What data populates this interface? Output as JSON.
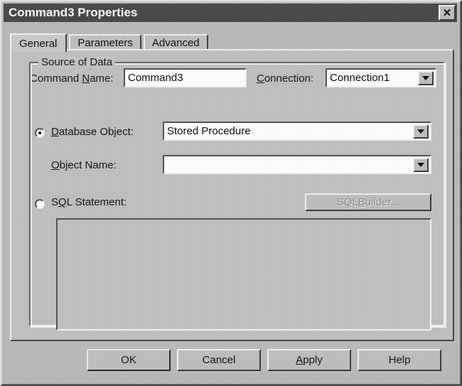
{
  "window": {
    "title": "Command3 Properties",
    "close_label": "✕",
    "close_icon": "close-icon"
  },
  "tabs": [
    {
      "label": "General",
      "active": true
    },
    {
      "label": "Parameters",
      "active": false
    },
    {
      "label": "Advanced",
      "active": false
    }
  ],
  "general": {
    "command_name": {
      "label_pre": "Command ",
      "label_accel": "N",
      "label_post": "ame:",
      "value": "Command3",
      "placeholder": ""
    },
    "connection": {
      "label_pre": "",
      "label_accel": "C",
      "label_post": "onnection:",
      "value": "Connection1",
      "options": [
        "Connection1"
      ]
    },
    "source_of_data": {
      "group_title": "Source of Data",
      "database_object": {
        "selected": true,
        "label_pre": "",
        "label_accel": "D",
        "label_post": "atabase Object:",
        "value": "Stored Procedure",
        "options": [
          "Stored Procedure"
        ]
      },
      "object_name": {
        "label_pre": "",
        "label_accel": "O",
        "label_post": "bject Name:",
        "value": "",
        "options": []
      },
      "sql_statement": {
        "selected": false,
        "label_pre": "S",
        "label_accel": "Q",
        "label_post": "L Statement:",
        "text": "",
        "enabled": false
      },
      "sql_builder_button": {
        "label_pre": "SQL ",
        "label_accel": "B",
        "label_post": "uilder...",
        "enabled": false
      }
    }
  },
  "footer": {
    "buttons": [
      {
        "label_pre": "OK",
        "label_accel": "",
        "label_post": "",
        "default": true
      },
      {
        "label_pre": "Cancel",
        "label_accel": "",
        "label_post": "",
        "default": false
      },
      {
        "label_pre": "",
        "label_accel": "A",
        "label_post": "pply",
        "default": false
      },
      {
        "label_pre": "Help",
        "label_accel": "",
        "label_post": "",
        "default": false
      }
    ]
  },
  "colors": {
    "titlebar": "#4c4c4c",
    "titlebar_text": "#ffffff",
    "face": "#c2c2c2",
    "field": "#ffffff",
    "text": "#141414",
    "disabled_text": "#8d8d8d"
  }
}
